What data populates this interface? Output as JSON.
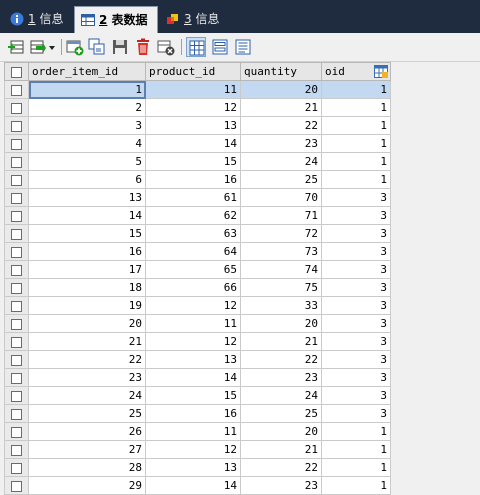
{
  "tabs": [
    {
      "num": "1",
      "label": " 信息",
      "icon": "info-icon",
      "active": false
    },
    {
      "num": "2",
      "label": " 表数据",
      "icon": "table-icon",
      "active": true
    },
    {
      "num": "3",
      "label": " 信息",
      "icon": "info-icon",
      "active": false
    }
  ],
  "toolbar": {
    "icons": [
      "insert-row-icon",
      "export-icon",
      "dropdown-arrow-icon",
      "add-row-icon",
      "duplicate-row-icon",
      "save-icon",
      "delete-icon",
      "cancel-icon",
      "grid-view-icon",
      "form-view-icon",
      "text-view-icon"
    ]
  },
  "grid": {
    "columns": [
      "order_item_id",
      "product_id",
      "quantity",
      "oid"
    ],
    "selected_row": 0,
    "rows": [
      [
        "1",
        "11",
        "20",
        "1"
      ],
      [
        "2",
        "12",
        "21",
        "1"
      ],
      [
        "3",
        "13",
        "22",
        "1"
      ],
      [
        "4",
        "14",
        "23",
        "1"
      ],
      [
        "5",
        "15",
        "24",
        "1"
      ],
      [
        "6",
        "16",
        "25",
        "1"
      ],
      [
        "13",
        "61",
        "70",
        "3"
      ],
      [
        "14",
        "62",
        "71",
        "3"
      ],
      [
        "15",
        "63",
        "72",
        "3"
      ],
      [
        "16",
        "64",
        "73",
        "3"
      ],
      [
        "17",
        "65",
        "74",
        "3"
      ],
      [
        "18",
        "66",
        "75",
        "3"
      ],
      [
        "19",
        "12",
        "33",
        "3"
      ],
      [
        "20",
        "11",
        "20",
        "3"
      ],
      [
        "21",
        "12",
        "21",
        "3"
      ],
      [
        "22",
        "13",
        "22",
        "3"
      ],
      [
        "23",
        "14",
        "23",
        "3"
      ],
      [
        "24",
        "15",
        "24",
        "3"
      ],
      [
        "25",
        "16",
        "25",
        "3"
      ],
      [
        "26",
        "11",
        "20",
        "1"
      ],
      [
        "27",
        "12",
        "21",
        "1"
      ],
      [
        "28",
        "13",
        "22",
        "1"
      ],
      [
        "29",
        "14",
        "23",
        "1"
      ]
    ]
  },
  "colors": {
    "tabbar_bg": "#1f2b3f",
    "row_highlight": "#c3d9f2"
  }
}
